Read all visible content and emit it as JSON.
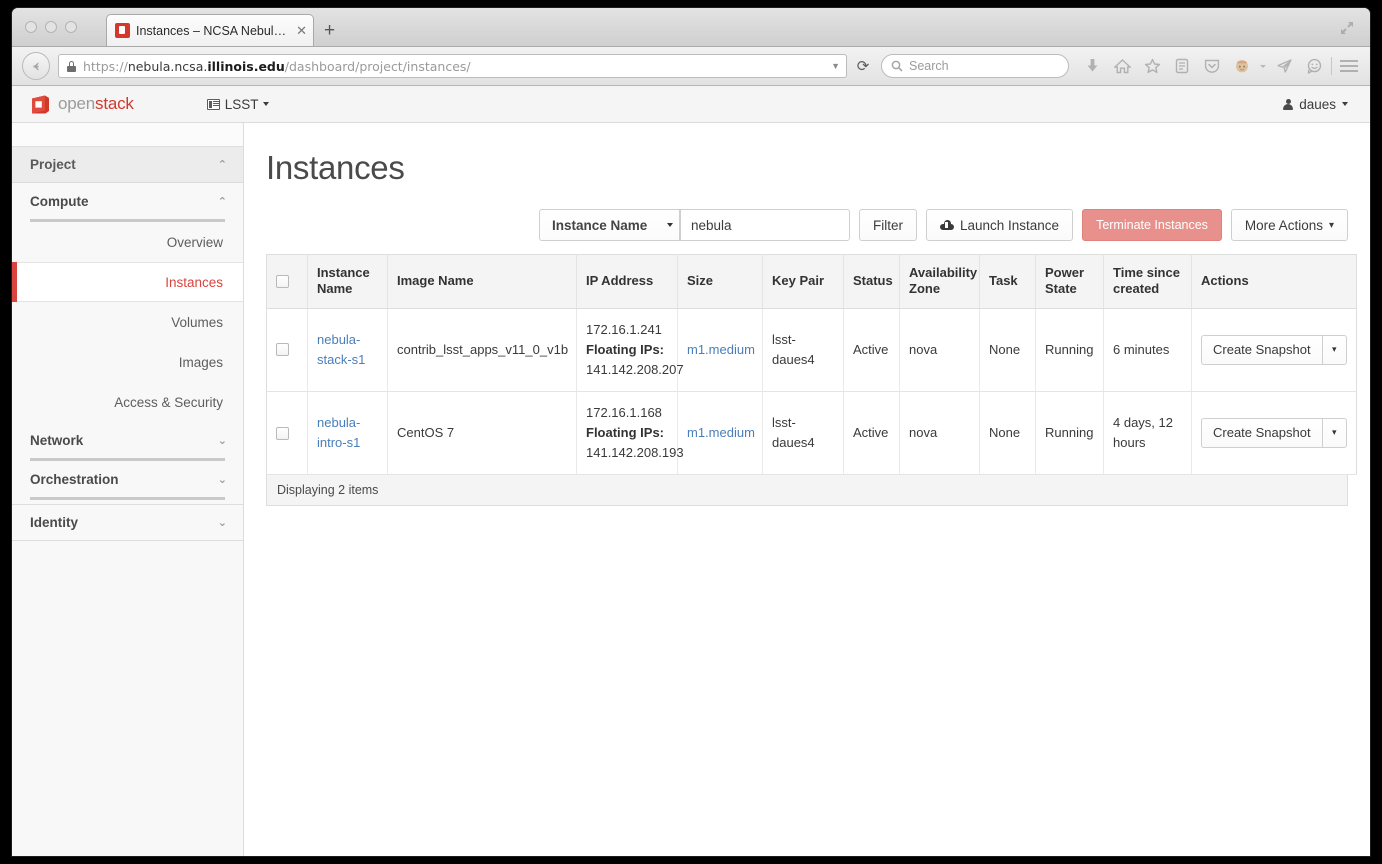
{
  "browser": {
    "tab_title": "Instances – NCSA Nebula ...",
    "tab_close": "✕",
    "new_tab": "+",
    "url_scheme": "https://",
    "url_sub": "nebula.ncsa.",
    "url_domain": "illinois.edu",
    "url_path": "/dashboard/project/instances/",
    "search_placeholder": "Search",
    "reload_glyph": "⟳",
    "url_caret": "▼",
    "toolbar_icons": [
      "download-icon",
      "home-icon",
      "bookmark-star-icon",
      "reading-list-icon",
      "pocket-shield-icon",
      "persona-face-icon",
      "persona-caret-icon",
      "send-tab-icon",
      "chat-smiley-icon",
      "hamburger-menu-icon"
    ],
    "window_expand_icon": "fullscreen-icon"
  },
  "topnav": {
    "brand_open": "open",
    "brand_stack": "stack",
    "tenant_label": "LSST",
    "user_label": "daues"
  },
  "sidebar": {
    "panel": {
      "label": "Project",
      "chevron": "⌃"
    },
    "groups": [
      {
        "label": "Compute",
        "chevron": "⌃",
        "expanded": true,
        "items": [
          {
            "label": "Overview",
            "active": false
          },
          {
            "label": "Instances",
            "active": true
          },
          {
            "label": "Volumes",
            "active": false
          },
          {
            "label": "Images",
            "active": false
          },
          {
            "label": "Access & Security",
            "active": false
          }
        ]
      },
      {
        "label": "Network",
        "chevron": "⌄",
        "expanded": false,
        "items": []
      },
      {
        "label": "Orchestration",
        "chevron": "⌄",
        "expanded": false,
        "items": []
      }
    ],
    "identity": {
      "label": "Identity",
      "chevron": "⌄"
    }
  },
  "main": {
    "title": "Instances",
    "filter": {
      "select_value": "Instance Name",
      "input_value": "nebula",
      "input_placeholder": "",
      "filter_button": "Filter"
    },
    "buttons": {
      "launch": "Launch Instance",
      "terminate": "Terminate Instances",
      "more_actions": "More Actions",
      "more_caret": "▾"
    },
    "table": {
      "columns": [
        "",
        "Instance Name",
        "Image Name",
        "IP Address",
        "Size",
        "Key Pair",
        "Status",
        "Availability Zone",
        "Task",
        "Power State",
        "Time since created",
        "Actions"
      ],
      "floating_label": "Floating IPs:",
      "action_label": "Create Snapshot",
      "action_caret": "▾",
      "rows": [
        {
          "instance_name": "nebula-stack-s1",
          "image_name": "contrib_lsst_apps_v11_0_v1b",
          "ip": "172.16.1.241",
          "floating_ip": "141.142.208.207",
          "size": "m1.medium",
          "key_pair": "lsst-daues4",
          "status": "Active",
          "zone": "nova",
          "task": "None",
          "power_state": "Running",
          "time_since_created": "6 minutes"
        },
        {
          "instance_name": "nebula-intro-s1",
          "image_name": "CentOS 7",
          "ip": "172.16.1.168",
          "floating_ip": "141.142.208.193",
          "size": "m1.medium",
          "key_pair": "lsst-daues4",
          "status": "Active",
          "zone": "nova",
          "task": "None",
          "power_state": "Running",
          "time_since_created": "4 days, 12 hours"
        }
      ],
      "footer": "Displaying 2 items"
    }
  },
  "colors": {
    "brand_red": "#cc3b30",
    "accent_red": "#d9443f",
    "danger": "#e8918c",
    "link_blue": "#4a7ebb"
  }
}
